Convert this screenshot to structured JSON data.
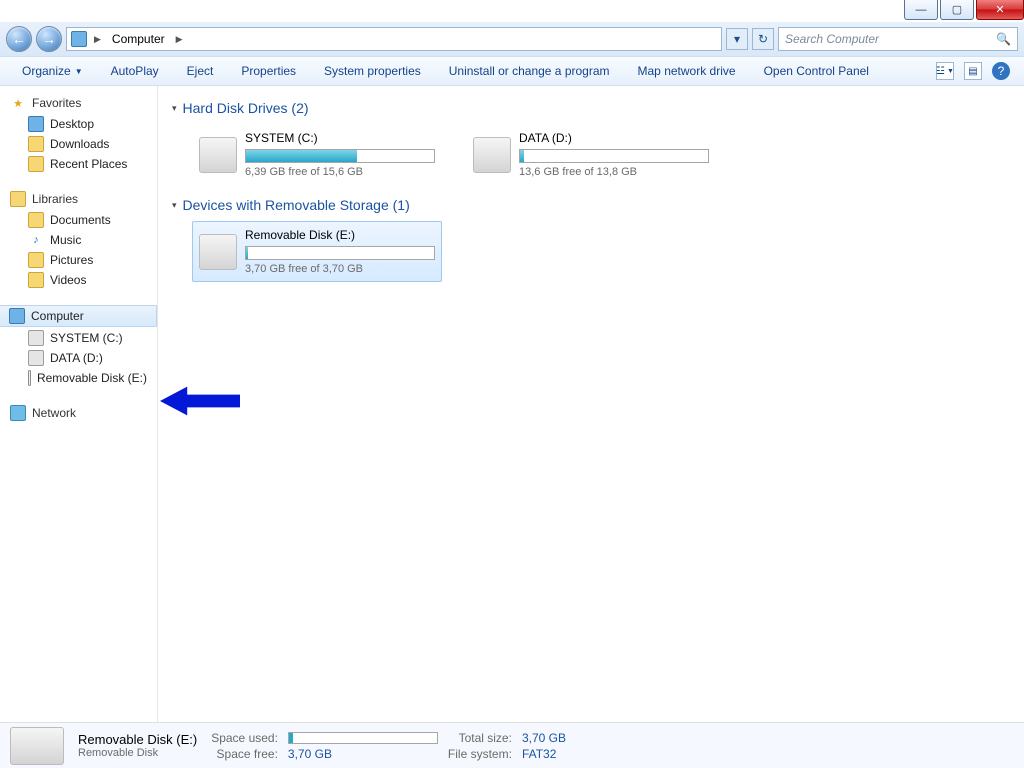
{
  "window_controls": {
    "min": "—",
    "max": "▢",
    "close": "✕"
  },
  "nav": {
    "back": "←",
    "forward": "→"
  },
  "address": {
    "icon_name": "computer-icon",
    "seg1": "Computer",
    "refresh": "↻"
  },
  "search": {
    "placeholder": "Search Computer",
    "mag": "🔍"
  },
  "toolbar": {
    "organize": "Organize",
    "autoplay": "AutoPlay",
    "eject": "Eject",
    "properties": "Properties",
    "system_properties": "System properties",
    "uninstall": "Uninstall or change a program",
    "map_drive": "Map network drive",
    "open_cp": "Open Control Panel"
  },
  "sidebar": {
    "favorites": "Favorites",
    "desktop": "Desktop",
    "downloads": "Downloads",
    "recent_places": "Recent Places",
    "libraries": "Libraries",
    "documents": "Documents",
    "music": "Music",
    "pictures": "Pictures",
    "videos": "Videos",
    "computer": "Computer",
    "system_c": "SYSTEM (C:)",
    "data_d": "DATA (D:)",
    "removable_e": "Removable Disk (E:)",
    "network": "Network"
  },
  "sections": {
    "hdd": "Hard Disk Drives (2)",
    "removable": "Devices with Removable Storage (1)"
  },
  "drives": {
    "sysC": {
      "title": "SYSTEM (C:)",
      "free": "6,39 GB free of 15,6 GB",
      "used_pct": 59
    },
    "dataD": {
      "title": "DATA (D:)",
      "free": "13,6 GB free of 13,8 GB",
      "used_pct": 2
    },
    "removE": {
      "title": "Removable Disk (E:)",
      "free": "3,70 GB free of 3,70 GB",
      "used_pct": 1
    }
  },
  "details": {
    "title": "Removable Disk (E:)",
    "subtitle": "Removable Disk",
    "label_used": "Space used:",
    "label_free": "Space free:",
    "value_free": "3,70 GB",
    "label_total": "Total size:",
    "value_total": "3,70 GB",
    "label_fs": "File system:",
    "value_fs": "FAT32"
  }
}
